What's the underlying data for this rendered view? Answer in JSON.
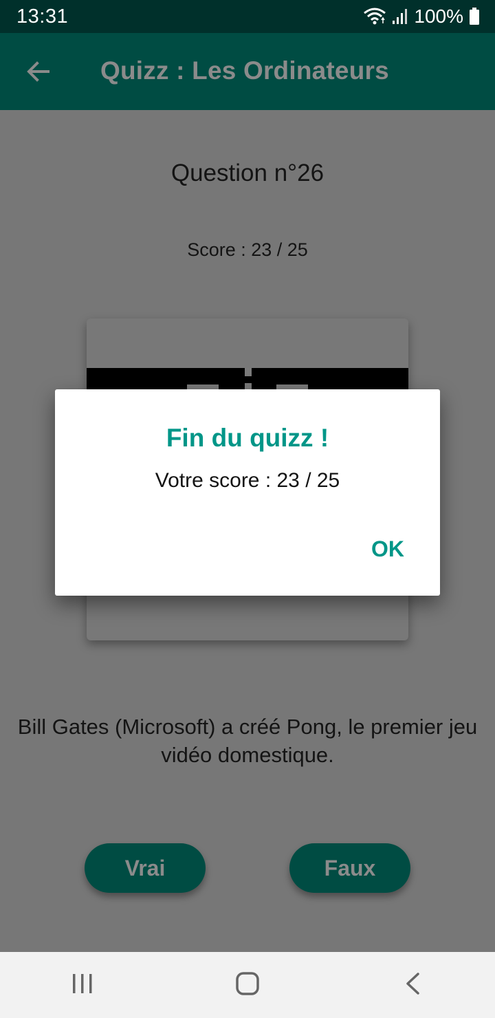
{
  "status_bar": {
    "time": "13:31",
    "battery_text": "100%",
    "icons": [
      "wifi-icon",
      "signal-icon",
      "battery-icon"
    ]
  },
  "app_bar": {
    "title": "Quizz : Les Ordinateurs",
    "back_icon": "arrow-back-icon"
  },
  "quiz": {
    "question_number": "Question n°26",
    "score": "Score : 23 / 25",
    "statement": "Bill Gates (Microsoft) a créé Pong, le premier jeu vidéo domestique.",
    "buttons": {
      "true_label": "Vrai",
      "false_label": "Faux"
    }
  },
  "dialog": {
    "title": "Fin du quizz !",
    "message": "Votre score : 23 / 25",
    "ok_label": "OK"
  },
  "nav_bar": {
    "items": [
      "recent-apps-icon",
      "home-icon",
      "back-icon"
    ]
  },
  "colors": {
    "status_bar_bg": "#00302b",
    "app_bar_bg": "#004c43",
    "accent": "#009688",
    "scrim_bg": "#777777",
    "nav_bar_bg": "#f2f2f2"
  }
}
